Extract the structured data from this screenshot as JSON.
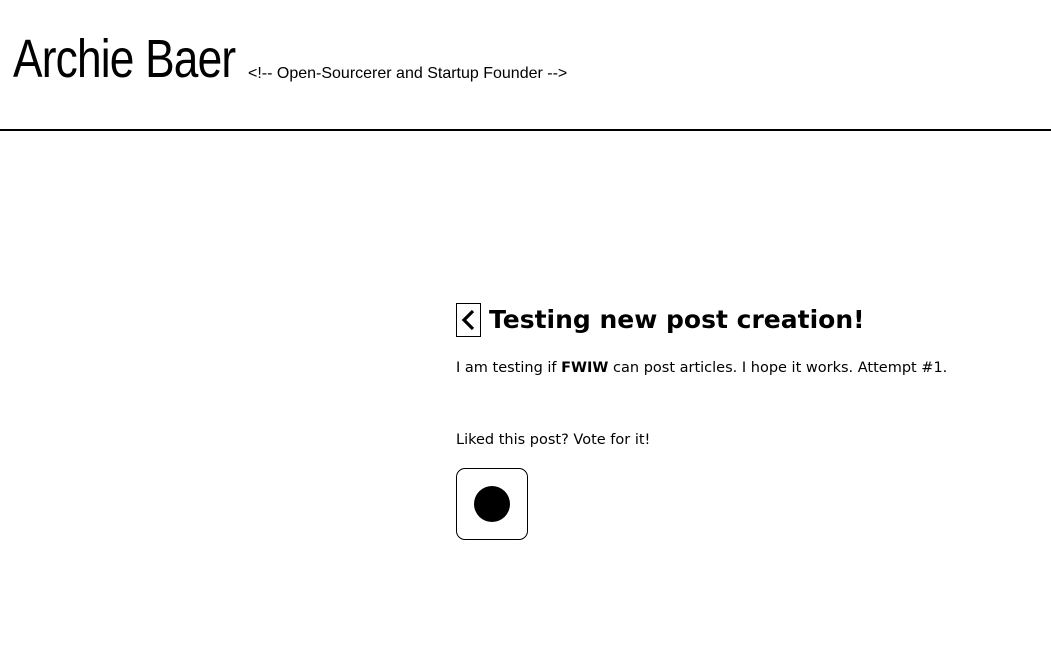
{
  "header": {
    "title": "Archie Baer",
    "tagline": "<!-- Open-Sourcerer and Startup Founder -->"
  },
  "post": {
    "back_icon": "chevron-left-icon",
    "title": "Testing new post creation!",
    "body_before": "I am testing if ",
    "body_strong": "FWIW",
    "body_after": " can post articles. I hope it works. Attempt #1.",
    "vote_prompt": "Liked this post? Vote for it!",
    "vote_icon": "filled-circle-icon"
  },
  "colors": {
    "text": "#000000",
    "background": "#ffffff"
  }
}
